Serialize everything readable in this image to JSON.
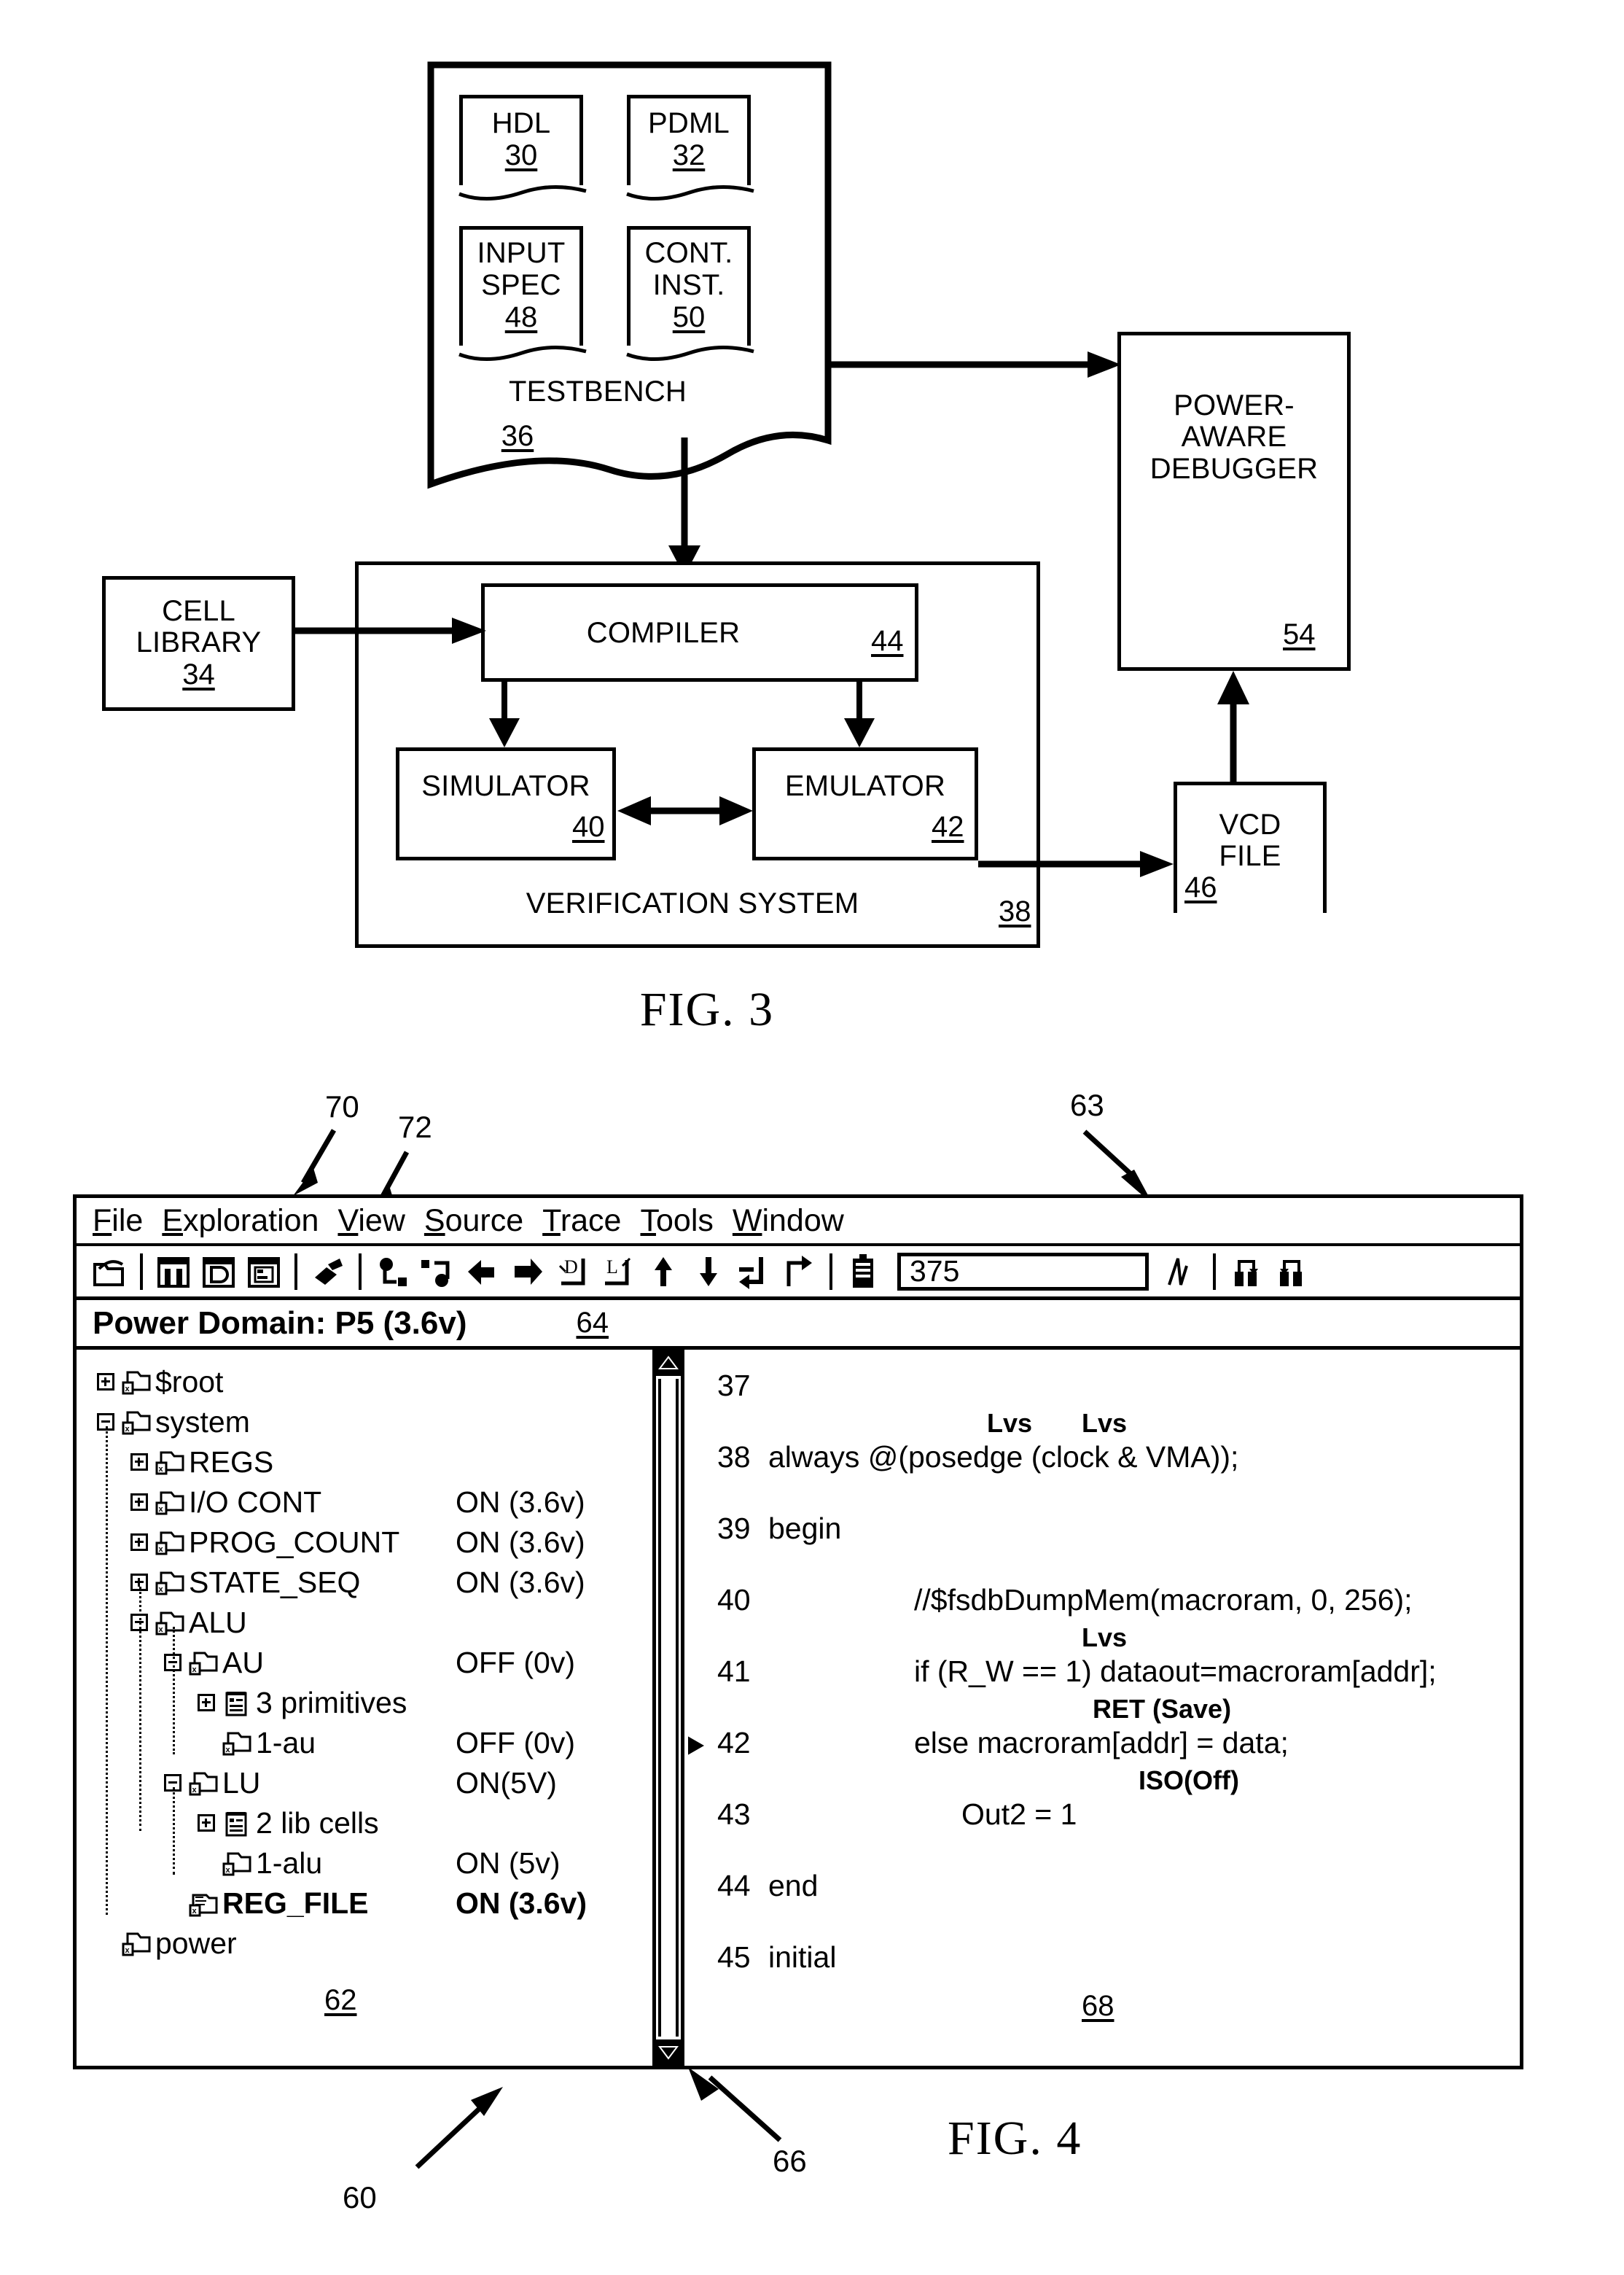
{
  "figures": {
    "fig3": {
      "title": "FIG. 3",
      "testbench": {
        "label": "TESTBENCH",
        "ref": "36",
        "docs": [
          {
            "name": "hdl",
            "lines": [
              "HDL"
            ],
            "ref": "30"
          },
          {
            "name": "pdml",
            "lines": [
              "PDML"
            ],
            "ref": "32"
          },
          {
            "name": "input-spec",
            "lines": [
              "INPUT",
              "SPEC"
            ],
            "ref": "48"
          },
          {
            "name": "cont-inst",
            "lines": [
              "CONT.",
              "INST."
            ],
            "ref": "50"
          }
        ]
      },
      "cell_library": {
        "lines": [
          "CELL",
          "LIBRARY"
        ],
        "ref": "34"
      },
      "verification_system": {
        "label": "VERIFICATION SYSTEM",
        "ref": "38",
        "compiler": {
          "label": "COMPILER",
          "ref": "44"
        },
        "simulator": {
          "label": "SIMULATOR",
          "ref": "40"
        },
        "emulator": {
          "label": "EMULATOR",
          "ref": "42"
        }
      },
      "power_aware_debugger": {
        "lines": [
          "POWER-",
          "AWARE",
          "DEBUGGER"
        ],
        "ref": "54"
      },
      "vcd_file": {
        "lines": [
          "VCD",
          "FILE"
        ],
        "ref": "46"
      }
    },
    "fig4": {
      "title": "FIG. 4",
      "callouts": {
        "window": "60",
        "menubar": "63",
        "tree_pane": "62",
        "power_domain_bar": "64",
        "scrollbar": "66",
        "code_pane": "68",
        "menu_exploration": "70",
        "menu_view": "72"
      },
      "menubar": {
        "items": [
          {
            "name": "file",
            "pre": "",
            "mnemonic": "F",
            "post": "ile"
          },
          {
            "name": "exploration",
            "pre": "",
            "mnemonic": "E",
            "post": "xploration"
          },
          {
            "name": "view",
            "pre": "",
            "mnemonic": "V",
            "post": "iew"
          },
          {
            "name": "source",
            "pre": "",
            "mnemonic": "S",
            "post": "ource"
          },
          {
            "name": "trace",
            "pre": "",
            "mnemonic": "T",
            "post": "race"
          },
          {
            "name": "tools",
            "pre": "",
            "mnemonic": "T",
            "post": "ools"
          },
          {
            "name": "window",
            "pre": "",
            "mnemonic": "W",
            "post": "indow"
          }
        ]
      },
      "toolbar": {
        "icons": [
          "open-folder-icon",
          "separator",
          "hierarchy-browser-icon",
          "schematic-view-icon",
          "source-view-icon",
          "separator",
          "flashlight-trace-icon",
          "separator",
          "step-into-icon",
          "step-over-icon",
          "trace-driver-icon",
          "trace-load-icon",
          "drivers-d-icon",
          "loads-l-icon",
          "go-up-icon",
          "go-down-icon",
          "goto-prev-icon",
          "goto-next-icon",
          "separator",
          "clipboard-icon"
        ],
        "time_field": {
          "value": "375",
          "placeholder": ""
        },
        "trailing_icons": [
          "waveform-icon",
          "separator",
          "search-prev-icon",
          "search-next-icon"
        ]
      },
      "power_domain_bar": {
        "label": "Power Domain: P5 (3.6v)"
      },
      "tree": {
        "rows": [
          {
            "name": "root",
            "depth": 0,
            "expander": "plus",
            "icon": "module-folder-icon",
            "label": "$root",
            "state": "",
            "bold": false
          },
          {
            "name": "system",
            "depth": 0,
            "expander": "minus",
            "icon": "module-folder-icon",
            "label": "system",
            "state": "",
            "bold": false
          },
          {
            "name": "regs",
            "depth": 1,
            "expander": "plus",
            "icon": "module-folder-icon",
            "label": "REGS",
            "state": "",
            "bold": false
          },
          {
            "name": "io-cont",
            "depth": 1,
            "expander": "plus",
            "icon": "module-folder-icon",
            "label": "I/O CONT",
            "state": "ON (3.6v)",
            "bold": false
          },
          {
            "name": "prog-count",
            "depth": 1,
            "expander": "plus",
            "icon": "module-folder-icon",
            "label": "PROG_COUNT",
            "state": "ON (3.6v)",
            "bold": false
          },
          {
            "name": "state-seq",
            "depth": 1,
            "expander": "plus",
            "icon": "module-folder-icon",
            "label": "STATE_SEQ",
            "state": "ON   (3.6v)",
            "bold": false
          },
          {
            "name": "alu",
            "depth": 1,
            "expander": "minus",
            "icon": "module-folder-icon",
            "label": "ALU",
            "state": "",
            "bold": false
          },
          {
            "name": "au",
            "depth": 2,
            "expander": "minus",
            "icon": "module-folder-icon",
            "label": "AU",
            "state": "OFF (0v)",
            "bold": false
          },
          {
            "name": "3-primitives",
            "depth": 3,
            "expander": "plus",
            "icon": "notepad-icon",
            "label": "3 primitives",
            "state": "",
            "bold": false
          },
          {
            "name": "1-au",
            "depth": 3,
            "expander": "none",
            "icon": "module-folder-icon",
            "label": "1-au",
            "state": "OFF (0v)",
            "bold": false
          },
          {
            "name": "lu",
            "depth": 2,
            "expander": "minus",
            "icon": "module-folder-icon",
            "label": "LU",
            "state": "ON(5V)",
            "bold": false
          },
          {
            "name": "2-lib-cells",
            "depth": 3,
            "expander": "plus",
            "icon": "notepad-icon",
            "label": "2 lib cells",
            "state": "",
            "bold": false
          },
          {
            "name": "1-alu",
            "depth": 3,
            "expander": "none",
            "icon": "module-folder-icon",
            "label": "1-alu",
            "state": "ON (5v)",
            "bold": false
          },
          {
            "name": "reg-file",
            "depth": 2,
            "expander": "none",
            "icon": "selected-module-icon",
            "label": "REG_FILE",
            "state": "ON (3.6v)",
            "bold": true
          },
          {
            "name": "power",
            "depth": 0,
            "expander": "none",
            "icon": "module-folder-icon",
            "label": "power",
            "state": "",
            "bold": false
          }
        ]
      },
      "code": {
        "lines": [
          {
            "name": "line-37",
            "num": "37",
            "text": "",
            "current": false,
            "annotations": []
          },
          {
            "name": "line-38",
            "num": "38",
            "text": "always @(posedge (clock & VMA));",
            "current": false,
            "annotations": [
              {
                "text": "Lvs",
                "offset": 300
              },
              {
                "text": "Lvs",
                "offset": 430
              }
            ]
          },
          {
            "name": "line-39",
            "num": "39",
            "text": "begin",
            "current": false,
            "annotations": []
          },
          {
            "name": "line-40",
            "num": "40",
            "text": "//$fsdbDumpMem(macroram, 0, 256);",
            "current": false,
            "annotations": [],
            "indent": 200
          },
          {
            "name": "line-41",
            "num": "41",
            "text": "if (R_W == 1) dataout=macroram[addr];",
            "current": false,
            "annotations": [
              {
                "text": "Lvs",
                "offset": 230
              }
            ],
            "indent": 200
          },
          {
            "name": "line-42",
            "num": "42",
            "text": "else macroram[addr] = data;",
            "current": true,
            "annotations": [
              {
                "text": "RET (Save)",
                "offset": 245
              }
            ],
            "indent": 200
          },
          {
            "name": "line-43",
            "num": "43",
            "text": "Out2 = 1",
            "current": false,
            "annotations": [
              {
                "text": "ISO(Off)",
                "offset": 243
              }
            ],
            "indent": 265
          },
          {
            "name": "line-44",
            "num": "44",
            "text": "end",
            "current": false,
            "annotations": []
          },
          {
            "name": "line-45",
            "num": "45",
            "text": "initial",
            "current": false,
            "annotations": []
          }
        ]
      }
    }
  }
}
